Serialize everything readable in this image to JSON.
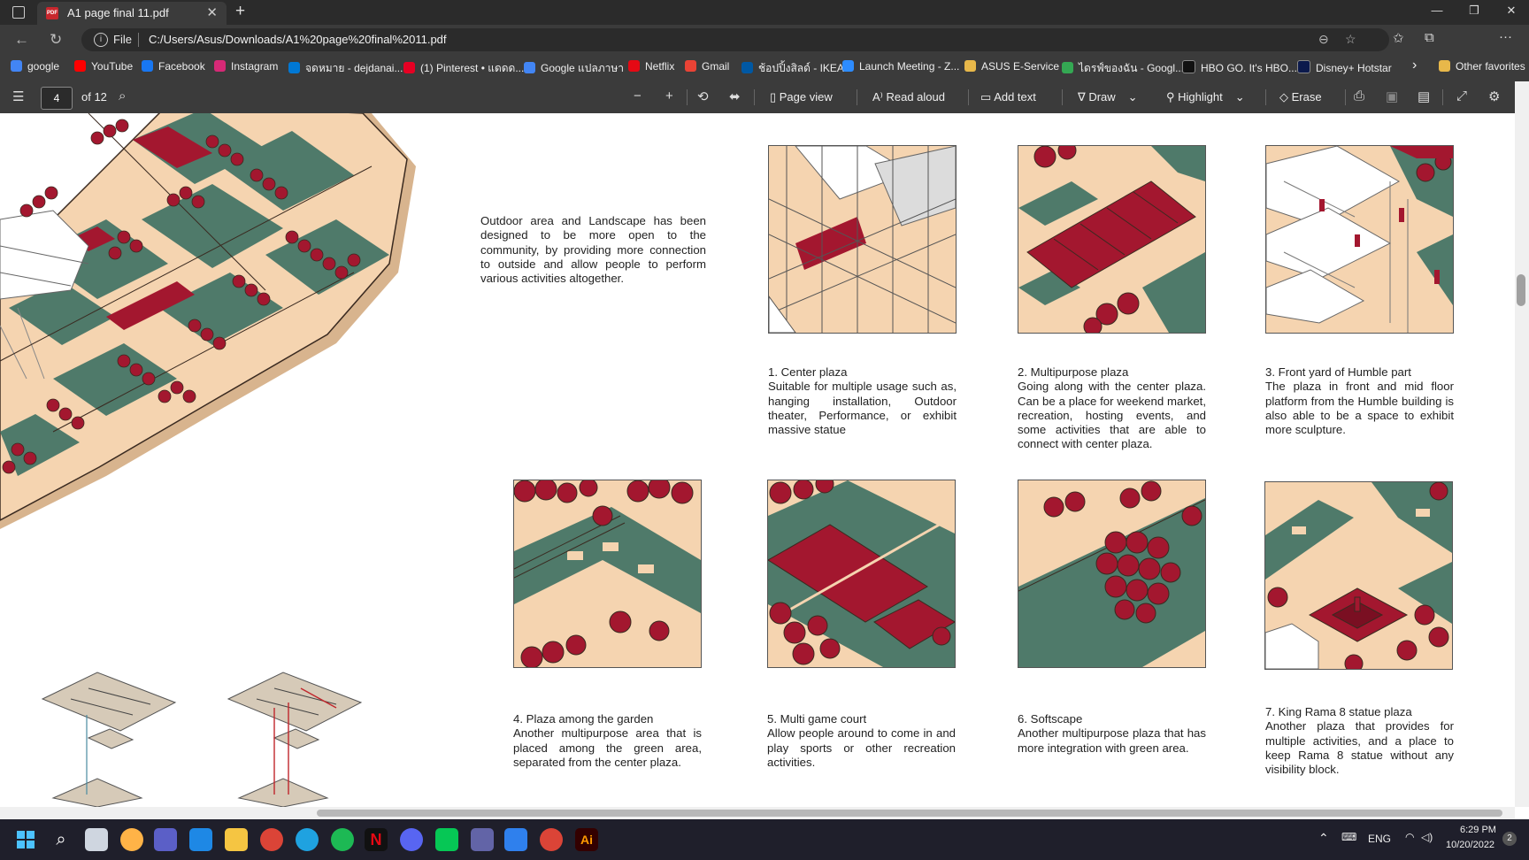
{
  "browser": {
    "tab_title": "A1 page final 11.pdf",
    "new_tab": "+",
    "close_tab": "✕",
    "address_prefix": "File",
    "url": "C:/Users/Asus/Downloads/A1%20page%20final%2011.pdf",
    "window_controls": [
      "—",
      "❐",
      "✕"
    ]
  },
  "bookmarks": [
    {
      "label": "google",
      "icon": "google-icon",
      "color": "#4285f4"
    },
    {
      "label": "YouTube",
      "icon": "youtube-icon",
      "color": "#ff0000"
    },
    {
      "label": "Facebook",
      "icon": "facebook-icon",
      "color": "#1877f2"
    },
    {
      "label": "Instagram",
      "icon": "instagram-icon",
      "color": "#d62976"
    },
    {
      "label": "จดหมาย - dejdanai...",
      "icon": "outlook-icon",
      "color": "#0078d4"
    },
    {
      "label": "(1) Pinterest • แดดด...",
      "icon": "pinterest-icon",
      "color": "#e60023"
    },
    {
      "label": "Google แปลภาษา",
      "icon": "translate-icon",
      "color": "#4285f4"
    },
    {
      "label": "Netflix",
      "icon": "netflix-icon",
      "color": "#e50914"
    },
    {
      "label": "Gmail",
      "icon": "gmail-icon",
      "color": "#ea4335"
    },
    {
      "label": "ช้อปปิ้งสิลด์ - IKEA",
      "icon": "ikea-icon",
      "color": "#0058a3"
    },
    {
      "label": "Launch Meeting - Z...",
      "icon": "zoom-icon",
      "color": "#2d8cff"
    },
    {
      "label": "ASUS E-Service",
      "icon": "folder-icon",
      "color": "#e8b84a"
    },
    {
      "label": "ไดรฟ์ของฉัน - Googl...",
      "icon": "drive-icon",
      "color": "#34a853"
    },
    {
      "label": "HBO GO. It's HBO...",
      "icon": "hbo-icon",
      "color": "#111111"
    },
    {
      "label": "Disney+ Hotstar",
      "icon": "hotstar-icon",
      "color": "#0c1a4c"
    }
  ],
  "bookmarks_more": "›",
  "other_favorites": "Other favorites",
  "pdf_toolbar": {
    "page_number": "4",
    "page_total": "of 12",
    "page_view": "Page view",
    "read_aloud": "Read aloud",
    "add_text": "Add text",
    "draw": "Draw",
    "highlight": "Highlight",
    "erase": "Erase"
  },
  "document": {
    "intro": "Outdoor area and Landscape has been designed to be more open to the community, by providing more connection to outside and allow people to perform various activities altogether.",
    "items": [
      {
        "title": "1. Center plaza",
        "body": "Suitable for multiple usage such as, hanging installation, Outdoor theater, Performance, or exhibit massive statue"
      },
      {
        "title": "2. Multipurpose plaza",
        "body": "Going along with the center plaza. Can be a place for weekend market, recreation, hosting events, and some activities that are able to connect with center plaza."
      },
      {
        "title": "3. Front yard of Humble part",
        "body": "The plaza in front and mid floor platform from the Humble building is also able to be a space to exhibit more sculpture."
      },
      {
        "title": "4. Plaza among the garden",
        "body": "Another multipurpose area that is placed among the green area, separated from the center plaza."
      },
      {
        "title": "5. Multi game court",
        "body": "Allow people around to come in and play sports or other recreation activities."
      },
      {
        "title": "6. Softscape",
        "body": "Another multipurpose plaza that has more integration with green area."
      },
      {
        "title": "7. King Rama 8 statue plaza",
        "body": "Another plaza that provides for multiple activities, and a place to keep Rama 8 statue without any visibility block."
      }
    ],
    "colors": {
      "sand": "#f5d4b0",
      "green": "#4f7a6a",
      "red": "#a3172f",
      "line": "#3a2a20"
    }
  },
  "taskbar": {
    "language": "ENG",
    "time": "6:29 PM",
    "date": "10/20/2022",
    "notification_count": "2"
  }
}
